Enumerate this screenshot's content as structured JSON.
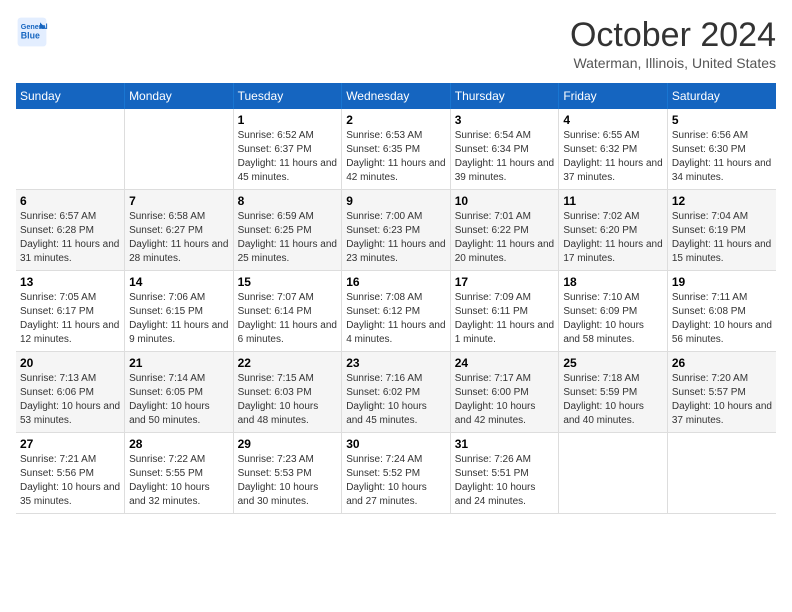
{
  "header": {
    "logo_line1": "General",
    "logo_line2": "Blue",
    "month": "October 2024",
    "location": "Waterman, Illinois, United States"
  },
  "days_of_week": [
    "Sunday",
    "Monday",
    "Tuesday",
    "Wednesday",
    "Thursday",
    "Friday",
    "Saturday"
  ],
  "weeks": [
    [
      {
        "num": "",
        "sunrise": "",
        "sunset": "",
        "daylight": ""
      },
      {
        "num": "",
        "sunrise": "",
        "sunset": "",
        "daylight": ""
      },
      {
        "num": "1",
        "sunrise": "Sunrise: 6:52 AM",
        "sunset": "Sunset: 6:37 PM",
        "daylight": "Daylight: 11 hours and 45 minutes."
      },
      {
        "num": "2",
        "sunrise": "Sunrise: 6:53 AM",
        "sunset": "Sunset: 6:35 PM",
        "daylight": "Daylight: 11 hours and 42 minutes."
      },
      {
        "num": "3",
        "sunrise": "Sunrise: 6:54 AM",
        "sunset": "Sunset: 6:34 PM",
        "daylight": "Daylight: 11 hours and 39 minutes."
      },
      {
        "num": "4",
        "sunrise": "Sunrise: 6:55 AM",
        "sunset": "Sunset: 6:32 PM",
        "daylight": "Daylight: 11 hours and 37 minutes."
      },
      {
        "num": "5",
        "sunrise": "Sunrise: 6:56 AM",
        "sunset": "Sunset: 6:30 PM",
        "daylight": "Daylight: 11 hours and 34 minutes."
      }
    ],
    [
      {
        "num": "6",
        "sunrise": "Sunrise: 6:57 AM",
        "sunset": "Sunset: 6:28 PM",
        "daylight": "Daylight: 11 hours and 31 minutes."
      },
      {
        "num": "7",
        "sunrise": "Sunrise: 6:58 AM",
        "sunset": "Sunset: 6:27 PM",
        "daylight": "Daylight: 11 hours and 28 minutes."
      },
      {
        "num": "8",
        "sunrise": "Sunrise: 6:59 AM",
        "sunset": "Sunset: 6:25 PM",
        "daylight": "Daylight: 11 hours and 25 minutes."
      },
      {
        "num": "9",
        "sunrise": "Sunrise: 7:00 AM",
        "sunset": "Sunset: 6:23 PM",
        "daylight": "Daylight: 11 hours and 23 minutes."
      },
      {
        "num": "10",
        "sunrise": "Sunrise: 7:01 AM",
        "sunset": "Sunset: 6:22 PM",
        "daylight": "Daylight: 11 hours and 20 minutes."
      },
      {
        "num": "11",
        "sunrise": "Sunrise: 7:02 AM",
        "sunset": "Sunset: 6:20 PM",
        "daylight": "Daylight: 11 hours and 17 minutes."
      },
      {
        "num": "12",
        "sunrise": "Sunrise: 7:04 AM",
        "sunset": "Sunset: 6:19 PM",
        "daylight": "Daylight: 11 hours and 15 minutes."
      }
    ],
    [
      {
        "num": "13",
        "sunrise": "Sunrise: 7:05 AM",
        "sunset": "Sunset: 6:17 PM",
        "daylight": "Daylight: 11 hours and 12 minutes."
      },
      {
        "num": "14",
        "sunrise": "Sunrise: 7:06 AM",
        "sunset": "Sunset: 6:15 PM",
        "daylight": "Daylight: 11 hours and 9 minutes."
      },
      {
        "num": "15",
        "sunrise": "Sunrise: 7:07 AM",
        "sunset": "Sunset: 6:14 PM",
        "daylight": "Daylight: 11 hours and 6 minutes."
      },
      {
        "num": "16",
        "sunrise": "Sunrise: 7:08 AM",
        "sunset": "Sunset: 6:12 PM",
        "daylight": "Daylight: 11 hours and 4 minutes."
      },
      {
        "num": "17",
        "sunrise": "Sunrise: 7:09 AM",
        "sunset": "Sunset: 6:11 PM",
        "daylight": "Daylight: 11 hours and 1 minute."
      },
      {
        "num": "18",
        "sunrise": "Sunrise: 7:10 AM",
        "sunset": "Sunset: 6:09 PM",
        "daylight": "Daylight: 10 hours and 58 minutes."
      },
      {
        "num": "19",
        "sunrise": "Sunrise: 7:11 AM",
        "sunset": "Sunset: 6:08 PM",
        "daylight": "Daylight: 10 hours and 56 minutes."
      }
    ],
    [
      {
        "num": "20",
        "sunrise": "Sunrise: 7:13 AM",
        "sunset": "Sunset: 6:06 PM",
        "daylight": "Daylight: 10 hours and 53 minutes."
      },
      {
        "num": "21",
        "sunrise": "Sunrise: 7:14 AM",
        "sunset": "Sunset: 6:05 PM",
        "daylight": "Daylight: 10 hours and 50 minutes."
      },
      {
        "num": "22",
        "sunrise": "Sunrise: 7:15 AM",
        "sunset": "Sunset: 6:03 PM",
        "daylight": "Daylight: 10 hours and 48 minutes."
      },
      {
        "num": "23",
        "sunrise": "Sunrise: 7:16 AM",
        "sunset": "Sunset: 6:02 PM",
        "daylight": "Daylight: 10 hours and 45 minutes."
      },
      {
        "num": "24",
        "sunrise": "Sunrise: 7:17 AM",
        "sunset": "Sunset: 6:00 PM",
        "daylight": "Daylight: 10 hours and 42 minutes."
      },
      {
        "num": "25",
        "sunrise": "Sunrise: 7:18 AM",
        "sunset": "Sunset: 5:59 PM",
        "daylight": "Daylight: 10 hours and 40 minutes."
      },
      {
        "num": "26",
        "sunrise": "Sunrise: 7:20 AM",
        "sunset": "Sunset: 5:57 PM",
        "daylight": "Daylight: 10 hours and 37 minutes."
      }
    ],
    [
      {
        "num": "27",
        "sunrise": "Sunrise: 7:21 AM",
        "sunset": "Sunset: 5:56 PM",
        "daylight": "Daylight: 10 hours and 35 minutes."
      },
      {
        "num": "28",
        "sunrise": "Sunrise: 7:22 AM",
        "sunset": "Sunset: 5:55 PM",
        "daylight": "Daylight: 10 hours and 32 minutes."
      },
      {
        "num": "29",
        "sunrise": "Sunrise: 7:23 AM",
        "sunset": "Sunset: 5:53 PM",
        "daylight": "Daylight: 10 hours and 30 minutes."
      },
      {
        "num": "30",
        "sunrise": "Sunrise: 7:24 AM",
        "sunset": "Sunset: 5:52 PM",
        "daylight": "Daylight: 10 hours and 27 minutes."
      },
      {
        "num": "31",
        "sunrise": "Sunrise: 7:26 AM",
        "sunset": "Sunset: 5:51 PM",
        "daylight": "Daylight: 10 hours and 24 minutes."
      },
      {
        "num": "",
        "sunrise": "",
        "sunset": "",
        "daylight": ""
      },
      {
        "num": "",
        "sunrise": "",
        "sunset": "",
        "daylight": ""
      }
    ]
  ]
}
